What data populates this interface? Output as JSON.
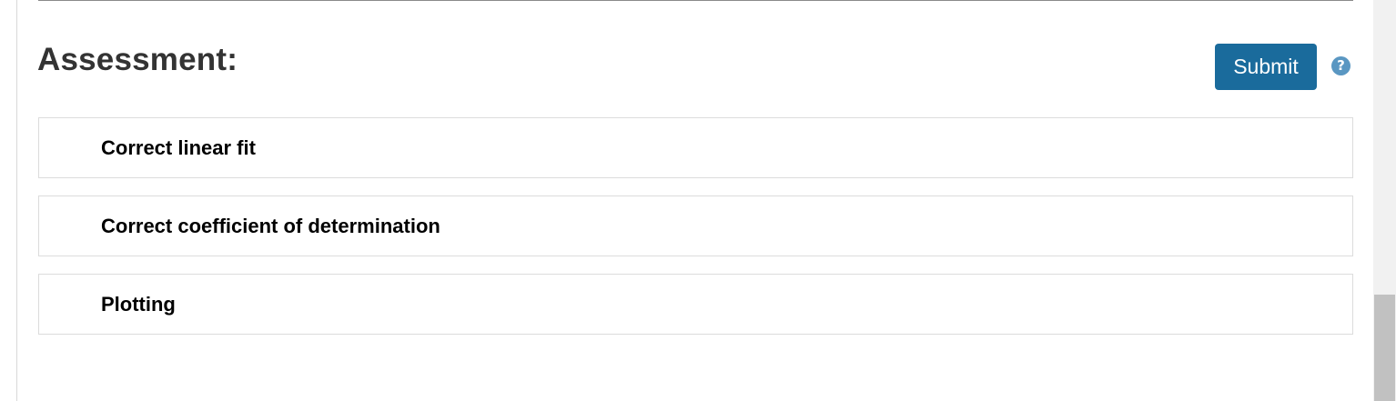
{
  "assessment": {
    "heading": "Assessment:",
    "submit_label": "Submit",
    "help_glyph": "?",
    "help_icon": "question-circle-icon",
    "colors": {
      "submit_bg": "#1a6b9c",
      "help_icon": "#5a97c2",
      "heading_text": "#333333"
    },
    "criteria": [
      {
        "label": "Correct linear fit"
      },
      {
        "label": "Correct coefficient of determination"
      },
      {
        "label": "Plotting"
      }
    ]
  }
}
